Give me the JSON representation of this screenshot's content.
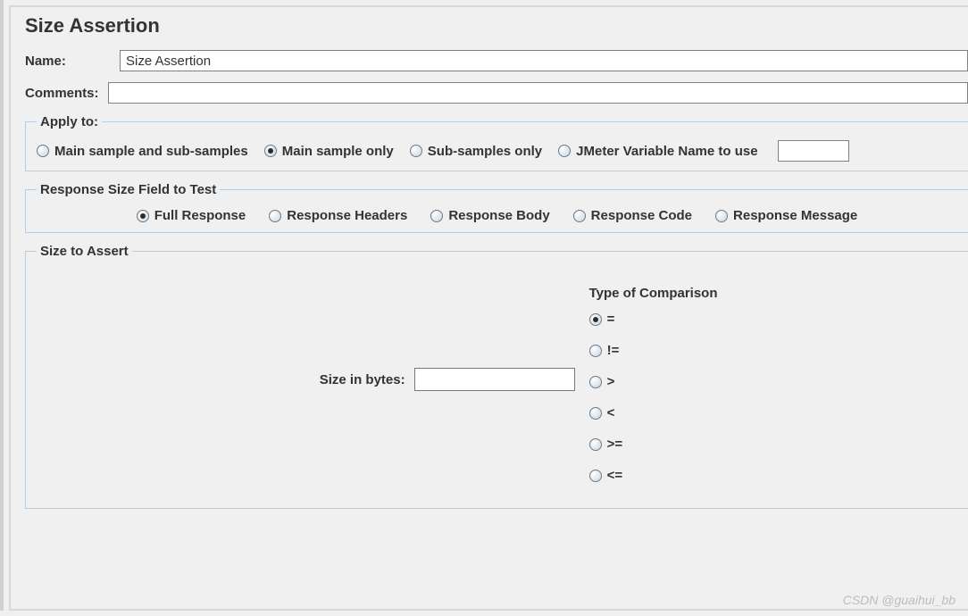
{
  "title": "Size Assertion",
  "fields": {
    "name_label": "Name:",
    "name_value": "Size Assertion",
    "comments_label": "Comments:",
    "comments_value": ""
  },
  "apply_to": {
    "legend": "Apply to:",
    "options": {
      "main_sub": "Main sample and sub-samples",
      "main_only": "Main sample only",
      "sub_only": "Sub-samples only",
      "jmeter_var": "JMeter Variable Name to use"
    },
    "selected": "main_only",
    "jmeter_var_value": ""
  },
  "response_field": {
    "legend": "Response Size Field to Test",
    "options": {
      "full": "Full Response",
      "headers": "Response Headers",
      "body": "Response Body",
      "code": "Response Code",
      "message": "Response Message"
    },
    "selected": "full"
  },
  "size_assert": {
    "legend": "Size to Assert",
    "size_label": "Size in bytes:",
    "size_value": "",
    "comparison_label": "Type of Comparison",
    "comparison_options": {
      "eq": "=",
      "ne": "!=",
      "gt": ">",
      "lt": "<",
      "ge": ">=",
      "le": "<="
    },
    "comparison_selected": "eq"
  },
  "watermark": "CSDN @guaihui_bb"
}
